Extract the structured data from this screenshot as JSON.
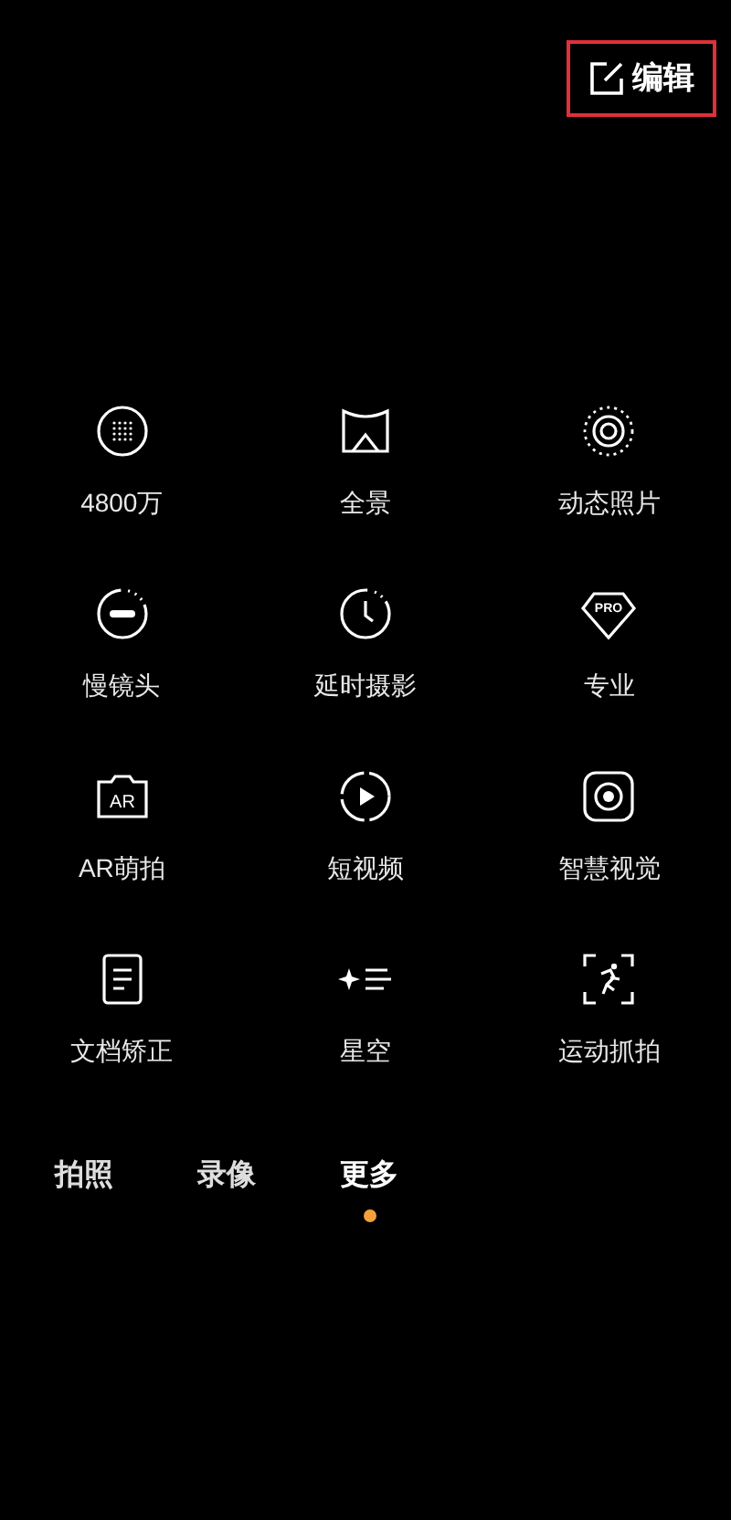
{
  "edit_button": {
    "label": "编辑",
    "highlighted": true
  },
  "modes": [
    {
      "kind": "grid",
      "label": "4800万"
    },
    {
      "kind": "panorama",
      "label": "全景"
    },
    {
      "kind": "live",
      "label": "动态照片"
    },
    {
      "kind": "slowmo",
      "label": "慢镜头"
    },
    {
      "kind": "timelapse",
      "label": "延时摄影"
    },
    {
      "kind": "pro",
      "label": "专业",
      "icon_text": "PRO"
    },
    {
      "kind": "ar",
      "label": "AR萌拍",
      "icon_text": "AR"
    },
    {
      "kind": "video",
      "label": "短视频"
    },
    {
      "kind": "vision",
      "label": "智慧视觉"
    },
    {
      "kind": "document",
      "label": "文档矫正"
    },
    {
      "kind": "stars",
      "label": "星空"
    },
    {
      "kind": "sport",
      "label": "运动抓拍"
    }
  ],
  "tabs": [
    {
      "label": "拍照",
      "selected": false
    },
    {
      "label": "录像",
      "selected": false
    },
    {
      "label": "更多",
      "selected": true
    }
  ]
}
